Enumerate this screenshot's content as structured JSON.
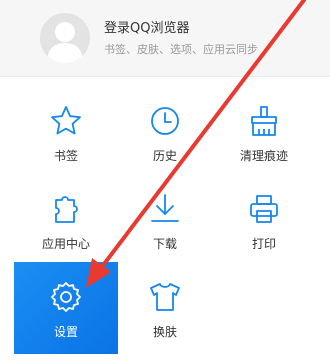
{
  "header": {
    "title": "登录QQ浏览器",
    "subtitle": "书签、皮肤、选项、应用云同步",
    "avatar_icon": "user-avatar-icon"
  },
  "menu": {
    "items": [
      {
        "label": "书签",
        "icon": "star-icon"
      },
      {
        "label": "历史",
        "icon": "clock-icon"
      },
      {
        "label": "清理痕迹",
        "icon": "broom-icon"
      },
      {
        "label": "应用中心",
        "icon": "puzzle-icon"
      },
      {
        "label": "下载",
        "icon": "download-icon"
      },
      {
        "label": "打印",
        "icon": "printer-icon"
      },
      {
        "label": "设置",
        "icon": "gear-icon",
        "highlighted": true
      },
      {
        "label": "换肤",
        "icon": "shirt-icon"
      }
    ]
  },
  "colors": {
    "accent": "#1588ee",
    "arrow": "#e83a30",
    "header_bg": "#f6f6f6"
  }
}
